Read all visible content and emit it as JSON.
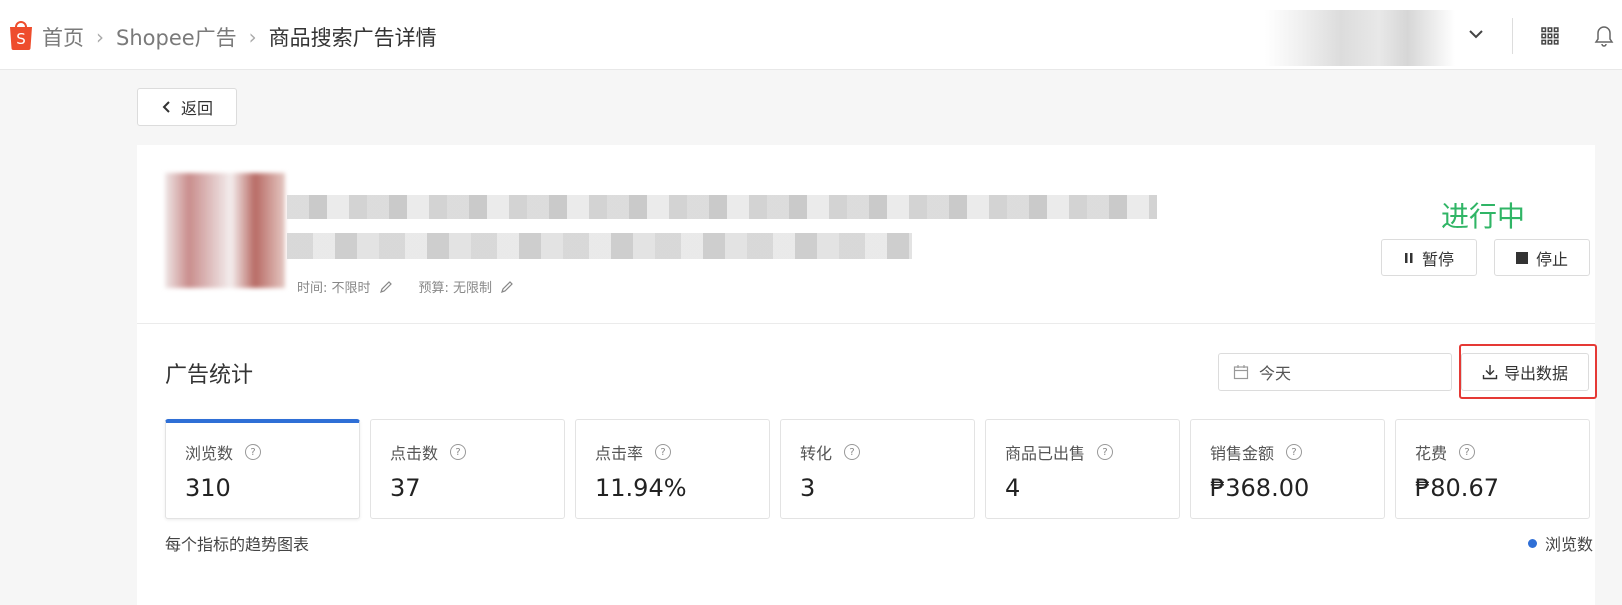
{
  "breadcrumb": {
    "home": "首页",
    "ads": "Shopee广告",
    "current": "商品搜索广告详情"
  },
  "back_label": "返回",
  "product": {
    "time_label": "时间: 不限时",
    "budget_label": "预算: 无限制"
  },
  "status": {
    "text": "进行中",
    "color": "#30b566",
    "pause_label": "暂停",
    "stop_label": "停止"
  },
  "stats": {
    "title": "广告统计",
    "date_value": "今天",
    "export_label": "导出数据",
    "cards": [
      {
        "label": "浏览数",
        "value": "310"
      },
      {
        "label": "点击数",
        "value": "37"
      },
      {
        "label": "点击率",
        "value": "11.94%"
      },
      {
        "label": "转化",
        "value": "3"
      },
      {
        "label": "商品已出售",
        "value": "4"
      },
      {
        "label": "销售金额",
        "value": "₱368.00"
      },
      {
        "label": "花费",
        "value": "₱80.67"
      }
    ],
    "trend_label": "每个指标的趋势图表",
    "legend_label": "浏览数",
    "legend_color": "#2f6fd6"
  },
  "colors": {
    "brand": "#ee4d2d",
    "accent": "#2f6fd6",
    "highlight": "#e53935"
  }
}
